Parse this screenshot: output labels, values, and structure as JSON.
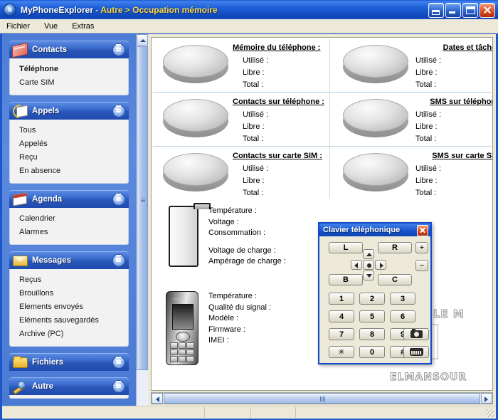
{
  "window": {
    "app_name": "MyPhoneExplorer",
    "separator": "-",
    "breadcrumb": "Autre > Occupation mémoire",
    "icon": "app-globe-icon",
    "buttons": {
      "restore_small": "restore-down",
      "minimize": "minimize",
      "maximize": "maximize",
      "close": "close"
    }
  },
  "menubar": {
    "items": [
      {
        "label": "Fichier"
      },
      {
        "label": "Vue"
      },
      {
        "label": "Extras"
      }
    ]
  },
  "sidebar": {
    "groups": [
      {
        "title": "Contacts",
        "icon": "address-book-icon",
        "chevron": "chevron-up-icon",
        "expanded": true,
        "items": [
          {
            "label": "Téléphone",
            "selected": true
          },
          {
            "label": "Carte SIM",
            "selected": false
          }
        ]
      },
      {
        "title": "Appels",
        "icon": "phone-call-icon",
        "chevron": "chevron-up-icon",
        "expanded": true,
        "items": [
          {
            "label": "Tous",
            "selected": false
          },
          {
            "label": "Appelés",
            "selected": false
          },
          {
            "label": "Reçu",
            "selected": false
          },
          {
            "label": "En absence",
            "selected": false
          }
        ]
      },
      {
        "title": "Agenda",
        "icon": "calendar-icon",
        "chevron": "chevron-up-icon",
        "expanded": true,
        "items": [
          {
            "label": "Calendrier",
            "selected": false
          },
          {
            "label": "Alarmes",
            "selected": false
          }
        ]
      },
      {
        "title": "Messages",
        "icon": "envelope-icon",
        "chevron": "chevron-up-icon",
        "expanded": true,
        "items": [
          {
            "label": "Reçus",
            "selected": false
          },
          {
            "label": "Brouillons",
            "selected": false
          },
          {
            "label": "Elements envoyés",
            "selected": false
          },
          {
            "label": "Eléments sauvegardés",
            "selected": false
          },
          {
            "label": "Archive (PC)",
            "selected": false
          }
        ]
      },
      {
        "title": "Fichiers",
        "icon": "folder-icon",
        "chevron": "chevron-down-icon",
        "expanded": false,
        "items": []
      },
      {
        "title": "Autre",
        "icon": "wrench-icon",
        "chevron": "chevron-up-icon",
        "expanded": true,
        "items": []
      }
    ],
    "scrollbar": {
      "up_arrow": "scroll-up-icon",
      "down_arrow": "scroll-down-icon"
    }
  },
  "main": {
    "memory_cells": [
      {
        "title": "Mémoire du téléphone :",
        "rows": [
          {
            "label": "Utilisé :",
            "value": ""
          },
          {
            "label": "Libre :",
            "value": ""
          },
          {
            "label": "Total :",
            "value": ""
          }
        ]
      },
      {
        "title": "Dates et tâches :",
        "rows": [
          {
            "label": "Utilisé :",
            "value": ""
          },
          {
            "label": "Libre :",
            "value": ""
          },
          {
            "label": "Total :",
            "value": ""
          }
        ]
      },
      {
        "title": "Contacts sur téléphone :",
        "rows": [
          {
            "label": "Utilisé :",
            "value": ""
          },
          {
            "label": "Libre :",
            "value": ""
          },
          {
            "label": "Total :",
            "value": ""
          }
        ]
      },
      {
        "title": "SMS sur téléphone :",
        "rows": [
          {
            "label": "Utilisé :",
            "value": ""
          },
          {
            "label": "Libre :",
            "value": ""
          },
          {
            "label": "Total :",
            "value": ""
          }
        ]
      },
      {
        "title": "Contacts sur carte SIM :",
        "rows": [
          {
            "label": "Utilisé :",
            "value": ""
          },
          {
            "label": "Libre :",
            "value": ""
          },
          {
            "label": "Total :",
            "value": ""
          }
        ]
      },
      {
        "title": "SMS sur carte SIM :",
        "rows": [
          {
            "label": "Utilisé :",
            "value": ""
          },
          {
            "label": "Libre :",
            "value": ""
          },
          {
            "label": "Total :",
            "value": ""
          }
        ]
      }
    ],
    "battery": {
      "icon": "battery-icon",
      "lines": [
        {
          "label": "Température :",
          "value": ""
        },
        {
          "label": "Voltage :",
          "value": ""
        },
        {
          "label": "Consommation :",
          "value": ""
        },
        {
          "label": "Voltage de charge :",
          "value": ""
        },
        {
          "label": "Ampérage de charge :",
          "value": ""
        }
      ]
    },
    "phone": {
      "icon": "mobile-phone-icon",
      "brand": "Sony Ericsson",
      "lines": [
        {
          "label": "Température :",
          "value": ""
        },
        {
          "label": "Qualité du signal :",
          "value": ""
        },
        {
          "label": "Modèle :",
          "value": ""
        },
        {
          "label": "Firmware :",
          "value": ""
        },
        {
          "label": "IMEI :",
          "value": ""
        }
      ]
    },
    "hscrollbar": {
      "left_arrow": "scroll-left-icon",
      "right_arrow": "scroll-right-icon"
    }
  },
  "keypad_dialog": {
    "title": "Clavier téléphonique",
    "close": "close-icon",
    "soft_keys": [
      {
        "label": "L"
      },
      {
        "label": "R"
      },
      {
        "label": "B"
      },
      {
        "label": "C"
      }
    ],
    "nav": {
      "up": "arrow-up-icon",
      "down": "arrow-down-icon",
      "left": "arrow-left-icon",
      "right": "arrow-right-icon",
      "ok": "center-select-icon"
    },
    "volume": [
      {
        "label": "+"
      },
      {
        "label": "−"
      }
    ],
    "numpad": [
      {
        "label": "1"
      },
      {
        "label": "2"
      },
      {
        "label": "3"
      },
      {
        "label": "4"
      },
      {
        "label": "5"
      },
      {
        "label": "6"
      },
      {
        "label": "7"
      },
      {
        "label": "8"
      },
      {
        "label": "9"
      },
      {
        "label": "✳"
      },
      {
        "label": "0"
      },
      {
        "label": "#"
      }
    ],
    "extra": [
      {
        "icon": "camera-icon"
      },
      {
        "icon": "keyboard-icon"
      }
    ]
  },
  "watermark": {
    "line1": "DOUBLE M",
    "line2": "M",
    "line3": "ELMANSOUR"
  },
  "colors": {
    "titlebar_blue": "#1d56c9",
    "sidebar_blue": "#4d7cd6",
    "panel_beige": "#ece9d8",
    "accent_yellow": "#ffd94a"
  }
}
